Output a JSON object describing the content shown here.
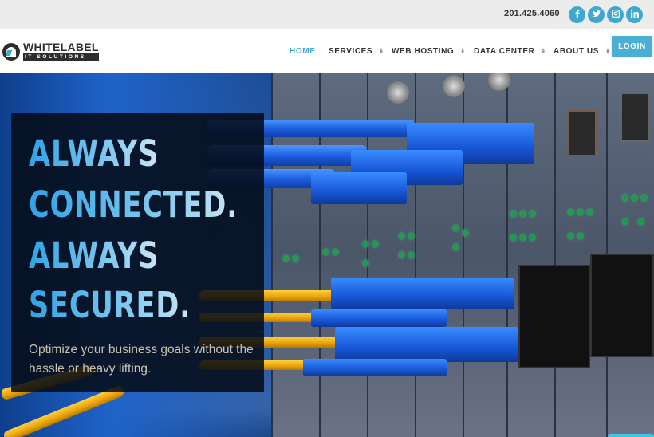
{
  "topbar": {
    "phone": "201.425.4060",
    "social": [
      {
        "name": "facebook",
        "glyph": "f"
      },
      {
        "name": "twitter",
        "glyph": "t"
      },
      {
        "name": "instagram",
        "glyph": "ig"
      },
      {
        "name": "linkedin",
        "glyph": "in"
      }
    ]
  },
  "header": {
    "logo": {
      "top": "WHITELABEL",
      "bottom": "IT SOLUTIONS"
    },
    "nav": [
      {
        "label": "HOME",
        "active": true,
        "has_dropdown": false
      },
      {
        "label": "SERVICES",
        "active": false,
        "has_dropdown": true
      },
      {
        "label": "WEB HOSTING",
        "active": false,
        "has_dropdown": true
      },
      {
        "label": "DATA CENTER",
        "active": false,
        "has_dropdown": true
      },
      {
        "label": "ABOUT US",
        "active": false,
        "has_dropdown": true
      }
    ],
    "dropdown_glyph": "»",
    "login_label": "LOGIN"
  },
  "hero": {
    "headline_lines": [
      "ALWAYS",
      "CONNECTED.",
      "ALWAYS",
      "SECURED."
    ],
    "subtext": "Optimize your business goals without the hassle or heavy lifting."
  },
  "colors": {
    "accent": "#3ea8cf",
    "login_bg": "#4aaed5",
    "topbar_bg": "#ececec",
    "text_dark": "#333333"
  }
}
